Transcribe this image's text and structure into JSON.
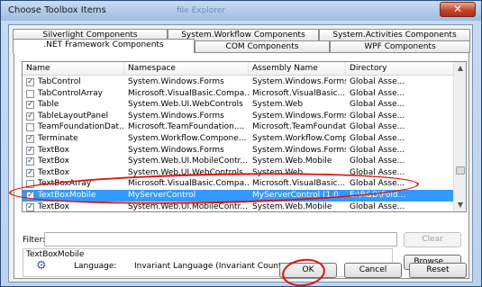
{
  "window": {
    "title": "Choose Toolbox Items",
    "ghost_title": "file Explorer",
    "close_glyph": "✕"
  },
  "tabs_row1": [
    {
      "label": "Silverlight Components"
    },
    {
      "label": "System.Workflow Components"
    },
    {
      "label": "System.Activities Components"
    }
  ],
  "tabs_row2": [
    {
      "label": ".NET Framework Components",
      "active": true
    },
    {
      "label": "COM Components"
    },
    {
      "label": "WPF Components"
    }
  ],
  "list": {
    "columns": [
      "Name",
      "Namespace",
      "Assembly Name",
      "Directory"
    ],
    "rows": [
      {
        "checked": true,
        "name": "TabControl",
        "namespace": "System.Windows.Forms",
        "assembly": "System.Windows.Forms",
        "directory": "Global Asse..."
      },
      {
        "checked": false,
        "name": "TabControlArray",
        "namespace": "Microsoft.VisualBasic.Compa...",
        "assembly": "Microsoft.VisualBasic...",
        "directory": "Global Asse..."
      },
      {
        "checked": true,
        "name": "Table",
        "namespace": "System.Web.UI.WebControls",
        "assembly": "System.Web",
        "directory": "Global Asse..."
      },
      {
        "checked": true,
        "name": "TableLayoutPanel",
        "namespace": "System.Windows.Forms",
        "assembly": "System.Windows.Forms",
        "directory": "Global Asse..."
      },
      {
        "checked": false,
        "name": "TeamFoundationDat...",
        "namespace": "Microsoft.TeamFoundation....",
        "assembly": "Microsoft.TeamFoundati...",
        "directory": "Global Asse..."
      },
      {
        "checked": true,
        "name": "Terminate",
        "namespace": "System.Workflow.Compone...",
        "assembly": "System.Workflow.Compo...",
        "directory": "Global Asse..."
      },
      {
        "checked": true,
        "name": "TextBox",
        "namespace": "System.Windows.Forms",
        "assembly": "System.Windows.Forms",
        "directory": "Global Asse..."
      },
      {
        "checked": true,
        "name": "TextBox",
        "namespace": "System.Web.UI.MobileContr...",
        "assembly": "System.Web.Mobile",
        "directory": "Global Asse..."
      },
      {
        "checked": true,
        "name": "TextBox",
        "namespace": "System.Web.UI.WebControls",
        "assembly": "System.Web",
        "directory": "Global Asse..."
      },
      {
        "checked": false,
        "name": "TextBoxArray",
        "namespace": "Microsoft.VisualBasic.Compa...",
        "assembly": "Microsoft.VisualBasic...",
        "directory": "Global Asse..."
      },
      {
        "checked": true,
        "name": "TextBoxMobile",
        "namespace": "MyServerControl",
        "assembly": "MyServerControl (1.0....",
        "directory": "E:\\R&D\\Fold...",
        "selected": true
      },
      {
        "checked": true,
        "name": "TextBox",
        "namespace": "System.Web.UI.MobileContr...",
        "assembly": "System.Web.Mobile",
        "directory": "Global Asse..."
      }
    ]
  },
  "filter": {
    "label": "Filter:",
    "value": "",
    "clear_label": "Clear"
  },
  "info": {
    "name": "TextBoxMobile",
    "language_label": "Language:",
    "language_value": "Invariant Language (Invariant Country)",
    "browse_label": "Browse...",
    "icon": "gear-icon"
  },
  "buttons": {
    "ok": "OK",
    "cancel": "Cancel",
    "reset": "Reset"
  },
  "colors": {
    "selection": "#3399ff",
    "annotation": "#e01010"
  }
}
